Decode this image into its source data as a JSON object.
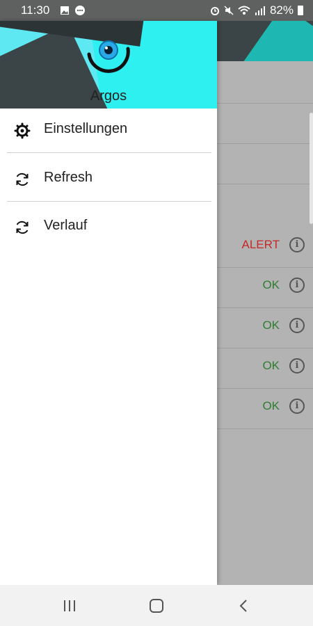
{
  "status_bar": {
    "time": "11:30",
    "battery": "82%",
    "left_icons": [
      "image-icon",
      "more-icon"
    ],
    "right_icons": [
      "alarm-icon",
      "mute-icon",
      "wifi-icon",
      "signal-icon",
      "battery-icon"
    ]
  },
  "drawer": {
    "app_name": "Argos",
    "items": [
      {
        "label": "Einstellungen",
        "icon": "gear-icon"
      },
      {
        "label": "Refresh",
        "icon": "refresh-icon"
      },
      {
        "label": "Verlauf",
        "icon": "history-icon"
      }
    ]
  },
  "background_list": {
    "rows": [
      {
        "status": "ALERT",
        "color": "#c62828"
      },
      {
        "status": "OK",
        "color": "#2e7d32"
      },
      {
        "status": "OK",
        "color": "#2e7d32"
      },
      {
        "status": "OK",
        "color": "#2e7d32"
      },
      {
        "status": "OK",
        "color": "#2e7d32"
      }
    ],
    "info_icon_glyph": "i"
  },
  "nav_bar": {
    "buttons": [
      "recent-apps-icon",
      "home-icon",
      "back-icon"
    ]
  },
  "colors": {
    "header_cyan": "#2ef0f0",
    "header_dark": "#3b4446",
    "status_bar": "#5f6161"
  }
}
